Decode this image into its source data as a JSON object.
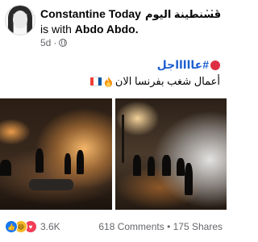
{
  "post": {
    "author": "Constantine Today",
    "author_arabic": "قسنطينة اليوم",
    "with_prefix": "is with",
    "tagged": "Abdo Abdo.",
    "time": "5d",
    "more": "···"
  },
  "text": {
    "line1": "#عاااااجل",
    "line2": "أعمال شغب بفرنسا الان"
  },
  "footer": {
    "reaction_count": "3.6K",
    "comments": "618 Comments",
    "separator": "•",
    "shares": "175 Shares"
  },
  "colors": {
    "hashtag": "#1d5fd1",
    "meta_gray": "#65676b",
    "like_blue": "#1877f2"
  },
  "icons": [
    "globe-icon",
    "more-icon",
    "red-circle-icon",
    "fire-icon",
    "france-flag-icon",
    "like-icon",
    "haha-icon",
    "love-icon"
  ]
}
